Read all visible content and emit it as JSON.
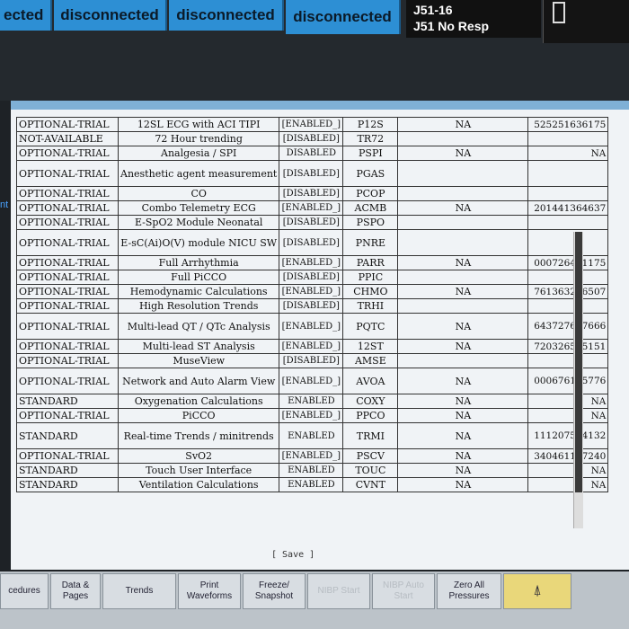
{
  "top": {
    "partial_label": "ected",
    "buttons": [
      "disconnected",
      "disconnected",
      "disconnected"
    ],
    "alarm_lines": [
      "J51-16",
      "J51 No Resp"
    ]
  },
  "side_label": "nt",
  "table": {
    "rows": [
      [
        "OPTIONAL-TRIAL",
        "12SL ECG with ACI TIPI",
        "[ENABLED_]",
        "P12S",
        "NA",
        "525251636175"
      ],
      [
        "NOT-AVAILABLE",
        "72 Hour trending",
        "[DISABLED]",
        "TR72",
        "",
        ""
      ],
      [
        "OPTIONAL-TRIAL",
        "Analgesia / SPI",
        "DISABLED",
        "PSPI",
        "NA",
        "NA"
      ],
      [
        "OPTIONAL-TRIAL",
        "Anesthetic agent measurement",
        "[DISABLED]",
        "PGAS",
        "",
        ""
      ],
      [
        "OPTIONAL-TRIAL",
        "CO",
        "[DISABLED]",
        "PCOP",
        "",
        ""
      ],
      [
        "OPTIONAL-TRIAL",
        "Combo Telemetry ECG",
        "[ENABLED_]",
        "ACMB",
        "NA",
        "201441364637"
      ],
      [
        "OPTIONAL-TRIAL",
        "E-SpO2 Module Neonatal",
        "[DISABLED]",
        "PSPO",
        "",
        ""
      ],
      [
        "OPTIONAL-TRIAL",
        "E-sC(Ai)O(V) module NICU SW",
        "[DISABLED]",
        "PNRE",
        "",
        ""
      ],
      [
        "OPTIONAL-TRIAL",
        "Full Arrhythmia",
        "[ENABLED_]",
        "PARR",
        "NA",
        "000726421175"
      ],
      [
        "OPTIONAL-TRIAL",
        "Full PiCCO",
        "[DISABLED]",
        "PPIC",
        "",
        ""
      ],
      [
        "OPTIONAL-TRIAL",
        "Hemodynamic Calculations",
        "[ENABLED_]",
        "CHMO",
        "NA",
        "761363246507"
      ],
      [
        "OPTIONAL-TRIAL",
        "High Resolution Trends",
        "[DISABLED]",
        "TRHI",
        "",
        ""
      ],
      [
        "OPTIONAL-TRIAL",
        "Multi-lead QT / QTc Analysis",
        "[ENABLED_]",
        "PQTC",
        "NA",
        "643727617666"
      ],
      [
        "OPTIONAL-TRIAL",
        "Multi-lead ST Analysis",
        "[ENABLED_]",
        "12ST",
        "NA",
        "720326575151"
      ],
      [
        "OPTIONAL-TRIAL",
        "MuseView",
        "[DISABLED]",
        "AMSE",
        "",
        ""
      ],
      [
        "OPTIONAL-TRIAL",
        "Network and Auto Alarm View",
        "[ENABLED_]",
        "AVOA",
        "NA",
        "000676175776"
      ],
      [
        "STANDARD",
        "Oxygenation Calculations",
        "ENABLED",
        "COXY",
        "NA",
        "NA"
      ],
      [
        "OPTIONAL-TRIAL",
        "PiCCO",
        "[ENABLED_]",
        "PPCO",
        "NA",
        "NA"
      ],
      [
        "STANDARD",
        "Real-time Trends / minitrends",
        "ENABLED",
        "TRMI",
        "NA",
        "111207504132"
      ],
      [
        "OPTIONAL-TRIAL",
        "SvO2",
        "[ENABLED_]",
        "PSCV",
        "NA",
        "340461177240"
      ],
      [
        "STANDARD",
        "Touch User Interface",
        "ENABLED",
        "TOUC",
        "NA",
        "NA"
      ],
      [
        "STANDARD",
        "Ventilation Calculations",
        "ENABLED",
        "CVNT",
        "NA",
        "NA"
      ]
    ]
  },
  "save_label": "[ Save ]",
  "bottom": {
    "buttons": [
      "cedures",
      "Data & Pages",
      "Trends",
      "Print Waveforms",
      "Freeze/ Snapshot",
      "NIBP Start",
      "NIBP Auto Start",
      "Zero All Pressures"
    ]
  }
}
